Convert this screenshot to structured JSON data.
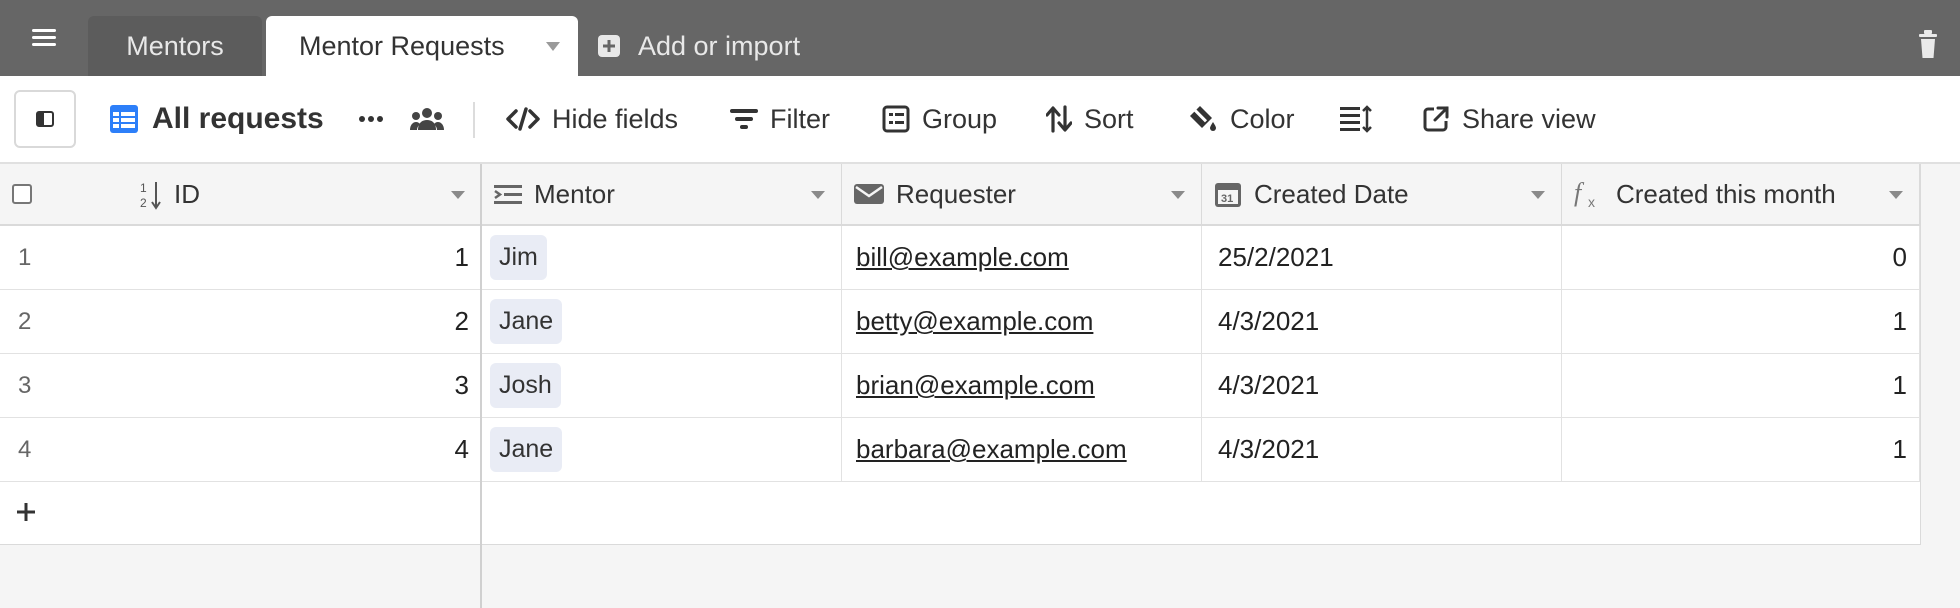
{
  "tabs": [
    {
      "label": "Mentors",
      "active": false
    },
    {
      "label": "Mentor Requests",
      "active": true
    }
  ],
  "add_import_label": "Add or import",
  "toolbar": {
    "view_name": "All requests",
    "hide_fields": "Hide fields",
    "filter": "Filter",
    "group": "Group",
    "sort": "Sort",
    "color": "Color",
    "share_view": "Share view"
  },
  "columns": {
    "id": "ID",
    "mentor": "Mentor",
    "requester": "Requester",
    "created_date": "Created Date",
    "created_this_month": "Created this month"
  },
  "rows": [
    {
      "n": "1",
      "id": "1",
      "mentor": "Jim",
      "requester": "bill@example.com",
      "created_date": "25/2/2021",
      "created_this_month": "0"
    },
    {
      "n": "2",
      "id": "2",
      "mentor": "Jane",
      "requester": "betty@example.com",
      "created_date": "4/3/2021",
      "created_this_month": "1"
    },
    {
      "n": "3",
      "id": "3",
      "mentor": "Josh",
      "requester": "brian@example.com",
      "created_date": "4/3/2021",
      "created_this_month": "1"
    },
    {
      "n": "4",
      "id": "4",
      "mentor": "Jane",
      "requester": "barbara@example.com",
      "created_date": "4/3/2021",
      "created_this_month": "1"
    }
  ],
  "colors": {
    "tabbar": "#666666",
    "grid_icon": "#2d7ff9",
    "pill": "#e9ecf5"
  }
}
